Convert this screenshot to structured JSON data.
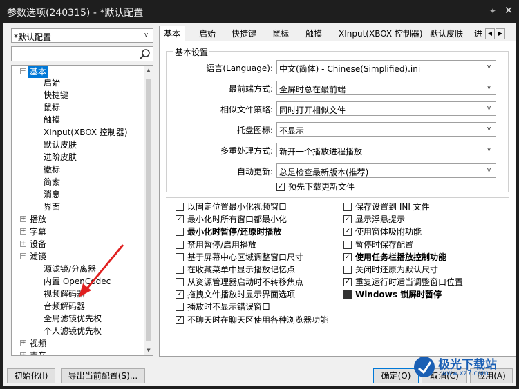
{
  "window": {
    "title": "参数选项(240315) - *默认配置",
    "pin_icon": "pin-icon",
    "close_icon": "close-icon"
  },
  "profile": {
    "value": "*默认配置"
  },
  "search": {
    "value": "",
    "icon": "search-icon"
  },
  "tree": {
    "root_basic": "基本",
    "basic_children": [
      "启始",
      "快捷键",
      "鼠标",
      "触摸",
      "XInput(XBOX 控制器)",
      "默认皮肤",
      "进阶皮肤",
      "徽标",
      "简索",
      "消息",
      "界面"
    ],
    "play": "播放",
    "subtitle": "字幕",
    "device": "设备",
    "filter": "滤镜",
    "filter_children": [
      "源滤镜/分离器",
      "内置 OpenCodec",
      "视频解码器",
      "音频解码器",
      "全局滤镜优先权",
      "个人滤镜优先权"
    ],
    "video": "视频",
    "audio": "声音"
  },
  "tabs": [
    "基本",
    "启始",
    "快捷键",
    "鼠标",
    "触摸",
    "XInput(XBOX 控制器)",
    "默认皮肤",
    "进"
  ],
  "basic_settings": {
    "legend": "基本设置",
    "language_label": "语言(Language):",
    "language_value": "中文(简体) - Chinese(Simplified).ini",
    "front_label": "最前端方式:",
    "front_value": "全屏时总在最前端",
    "similar_label": "相似文件策略:",
    "similar_value": "同时打开相似文件",
    "tray_label": "托盘图标:",
    "tray_value": "不显示",
    "multi_label": "多重处理方式:",
    "multi_value": "新开一个播放进程播放",
    "update_label": "自动更新:",
    "update_value": "总是检查最新版本(推荐)",
    "predownload": "预先下载更新文件"
  },
  "options_left": [
    {
      "label": "以固定位置最小化视频窗口",
      "checked": false
    },
    {
      "label": "最小化时所有窗口都最小化",
      "checked": true
    },
    {
      "label": "最小化时暂停/还原时播放",
      "checked": false,
      "bold": true
    },
    {
      "label": "禁用暂停/启用播放",
      "checked": false
    },
    {
      "label": "基于屏幕中心区域调整窗口尺寸",
      "checked": false
    },
    {
      "label": "在收藏菜单中显示播放记忆点",
      "checked": false
    },
    {
      "label": "从资源管理器启动时不转移焦点",
      "checked": false
    },
    {
      "label": "拖拽文件播放时显示界面选项",
      "checked": true
    },
    {
      "label": "播放时不显示错误窗口",
      "checked": false
    },
    {
      "label": "不聊天时在聊天区使用各种浏览器功能",
      "checked": true
    }
  ],
  "options_right": [
    {
      "label": "保存设置到 INI 文件",
      "checked": false
    },
    {
      "label": "显示浮悬提示",
      "checked": true
    },
    {
      "label": "使用窗体吸附功能",
      "checked": true
    },
    {
      "label": "暂停时保存配置",
      "checked": false
    },
    {
      "label": "使用任务栏播放控制功能",
      "checked": true,
      "bold": true
    },
    {
      "label": "关闭时还原为默认尺寸",
      "checked": false
    },
    {
      "label": "重复运行时适当调整窗口位置",
      "checked": true
    },
    {
      "label": "Windows 锁屏时暂停",
      "checked": "partial",
      "bold": true
    }
  ],
  "buttons": {
    "init": "初始化(I)",
    "export": "导出当前配置(S)...",
    "ok": "确定(O)",
    "cancel": "取消(C)",
    "apply": "应用(A)"
  },
  "watermark": {
    "text": "极光下载站",
    "sub": "www.xz7.com"
  },
  "colors": {
    "selected": "#0078d7",
    "titlebar": "#1e1e1e",
    "arrow": "#e02020"
  }
}
